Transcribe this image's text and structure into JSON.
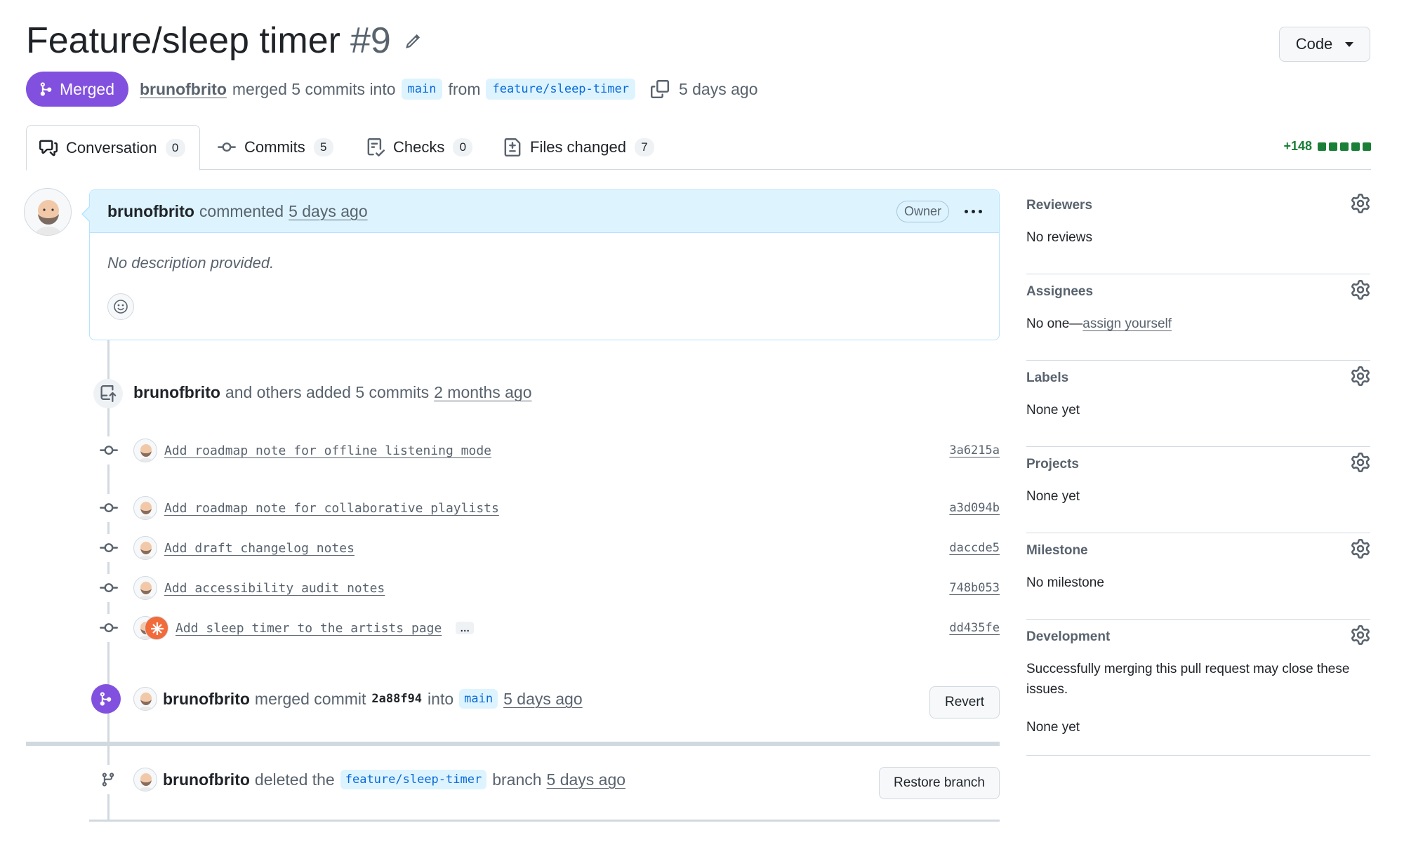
{
  "header": {
    "title": "Feature/sleep timer",
    "number": "#9",
    "code_button": "Code"
  },
  "meta": {
    "status": "Merged",
    "author": "brunofbrito",
    "action": "merged 5 commits into",
    "base_branch": "main",
    "from_text": "from",
    "head_branch": "feature/sleep-timer",
    "time": "5 days ago"
  },
  "tabs": [
    {
      "label": "Conversation",
      "count": "0"
    },
    {
      "label": "Commits",
      "count": "5"
    },
    {
      "label": "Checks",
      "count": "0"
    },
    {
      "label": "Files changed",
      "count": "7"
    }
  ],
  "diffstat": "+148",
  "comment": {
    "author": "brunofbrito",
    "action": "commented",
    "time": "5 days ago",
    "badge": "Owner",
    "body": "No description provided."
  },
  "commits_event": {
    "author": "brunofbrito",
    "action": "and others added 5 commits",
    "time": "2 months ago"
  },
  "commits": [
    {
      "message": "Add roadmap note for offline listening mode",
      "sha": "3a6215a"
    },
    {
      "message": "Add roadmap note for collaborative playlists",
      "sha": "a3d094b"
    },
    {
      "message": "Add draft changelog notes",
      "sha": "daccde5"
    },
    {
      "message": "Add accessibility audit notes",
      "sha": "748b053"
    },
    {
      "message": "Add sleep timer to the artists page",
      "sha": "dd435fe",
      "ellipsis": "…"
    }
  ],
  "merge_event": {
    "author": "brunofbrito",
    "action": "merged commit",
    "sha": "2a88f94",
    "into": "into",
    "branch": "main",
    "time": "5 days ago",
    "button": "Revert"
  },
  "delete_event": {
    "author": "brunofbrito",
    "action": "deleted the",
    "branch": "feature/sleep-timer",
    "suffix": "branch",
    "time": "5 days ago",
    "button": "Restore branch"
  },
  "sidebar": {
    "reviewers": {
      "title": "Reviewers",
      "value": "No reviews"
    },
    "assignees": {
      "title": "Assignees",
      "value_prefix": "No one—",
      "value_link": "assign yourself"
    },
    "labels": {
      "title": "Labels",
      "value": "None yet"
    },
    "projects": {
      "title": "Projects",
      "value": "None yet"
    },
    "milestone": {
      "title": "Milestone",
      "value": "No milestone"
    },
    "development": {
      "title": "Development",
      "value": "Successfully merging this pull request may close these issues.",
      "value2": "None yet"
    }
  },
  "colors": {
    "merged": "#8250df",
    "branch_bg": "#ddf4ff",
    "branch_fg": "#0969da",
    "additions": "#1a7f37"
  }
}
